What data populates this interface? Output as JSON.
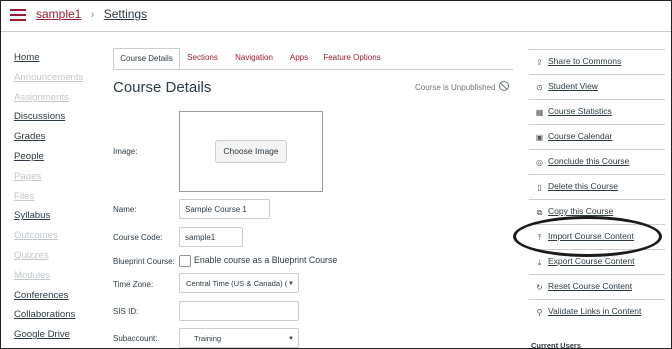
{
  "breadcrumb": {
    "course": "sample1",
    "current": "Settings"
  },
  "left_nav": [
    {
      "label": "Home",
      "enabled": true
    },
    {
      "label": "Announcements",
      "enabled": false
    },
    {
      "label": "Assignments",
      "enabled": false
    },
    {
      "label": "Discussions",
      "enabled": true
    },
    {
      "label": "Grades",
      "enabled": true
    },
    {
      "label": "People",
      "enabled": true
    },
    {
      "label": "Pages",
      "enabled": false
    },
    {
      "label": "Files",
      "enabled": false
    },
    {
      "label": "Syllabus",
      "enabled": true
    },
    {
      "label": "Outcomes",
      "enabled": false
    },
    {
      "label": "Quizzes",
      "enabled": false
    },
    {
      "label": "Modules",
      "enabled": false
    },
    {
      "label": "Conferences",
      "enabled": true
    },
    {
      "label": "Collaborations",
      "enabled": true
    },
    {
      "label": "Google Drive",
      "enabled": true
    }
  ],
  "tabs": [
    "Course Details",
    "Sections",
    "Navigation",
    "Apps",
    "Feature Options"
  ],
  "main": {
    "title": "Course Details",
    "status": "Course is Unpublished",
    "image_label": "Image:",
    "choose_image": "Choose Image",
    "name_label": "Name:",
    "name_value": "Sample Course 1",
    "code_label": "Course Code:",
    "code_value": "sample1",
    "blueprint_label": "Blueprint Course:",
    "blueprint_checkbox_label": "Enable course as a Blueprint Course",
    "timezone_label": "Time Zone:",
    "timezone_value": "Central Time (US & Canada) (",
    "sis_label": "SIS ID:",
    "sis_value": "",
    "subaccount_label": "Subaccount:",
    "subaccount_value": "Training"
  },
  "sidebar": {
    "items": [
      {
        "label": "Share to Commons",
        "icon": "share-icon"
      },
      {
        "label": "Student View",
        "icon": "glasses-icon"
      },
      {
        "label": "Course Statistics",
        "icon": "stats-icon"
      },
      {
        "label": "Course Calendar",
        "icon": "calendar-icon"
      },
      {
        "label": "Conclude this Course",
        "icon": "check-circle-icon"
      },
      {
        "label": "Delete this Course",
        "icon": "trash-icon"
      },
      {
        "label": "Copy this Course",
        "icon": "copy-icon"
      },
      {
        "label": "Import Course Content",
        "icon": "upload-icon"
      },
      {
        "label": "Export Course Content",
        "icon": "download-icon"
      },
      {
        "label": "Reset Course Content",
        "icon": "reset-icon"
      },
      {
        "label": "Validate Links in Content",
        "icon": "link-icon"
      }
    ],
    "current_users": "Current Users"
  },
  "colors": {
    "accent": "#9b1b30",
    "text": "#2d3b45",
    "disabled": "#c2c7cc",
    "border": "#c7cdd1"
  }
}
